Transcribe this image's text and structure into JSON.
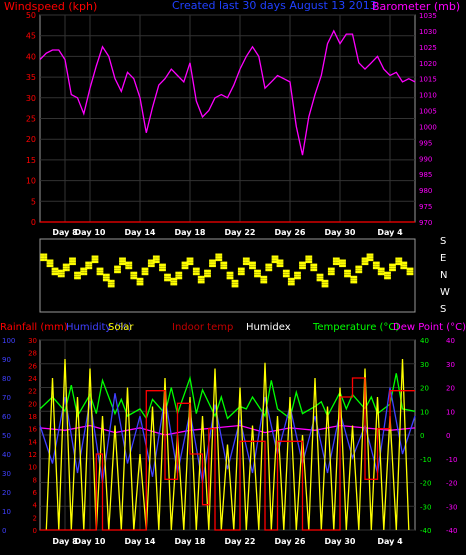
{
  "chart_data": [
    {
      "type": "line",
      "title": "Created last 30 days August 13 2013",
      "left_axis": {
        "label": "Windspeed (kph)",
        "min": 0,
        "max": 50,
        "ticks": [
          0,
          5,
          10,
          15,
          20,
          25,
          30,
          35,
          40,
          45,
          50
        ],
        "color": "#ff0000"
      },
      "right_axis": {
        "label": "Barometer (mb)",
        "min": 970,
        "max": 1035,
        "ticks": [
          970,
          975,
          980,
          985,
          990,
          995,
          1000,
          1005,
          1010,
          1015,
          1020,
          1025,
          1030,
          1035
        ],
        "color": "#ff00ff"
      },
      "x_labels": [
        "Day 8",
        "Day 10",
        "Day 14",
        "Day 18",
        "Day 22",
        "Day 26",
        "Day 30",
        "Day 4"
      ],
      "x_label_days": [
        8,
        10,
        14,
        18,
        22,
        26,
        30,
        34
      ],
      "x_range": [
        6,
        36
      ],
      "series": [
        {
          "name": "Barometer (mb)",
          "color": "#ff00ff",
          "axis": "right",
          "x": [
            6,
            6.5,
            7,
            7.5,
            8,
            8.5,
            9,
            9.5,
            10,
            10.5,
            11,
            11.5,
            12,
            12.5,
            13,
            13.5,
            14,
            14.5,
            15,
            15.5,
            16,
            16.5,
            17,
            17.5,
            18,
            18.5,
            19,
            19.5,
            20,
            20.5,
            21,
            21.5,
            22,
            22.5,
            23,
            23.5,
            24,
            24.5,
            25,
            25.5,
            26,
            26.5,
            27,
            27.5,
            28,
            28.5,
            29,
            29.5,
            30,
            30.5,
            31,
            31.5,
            32,
            32.5,
            33,
            33.5,
            34,
            34.5,
            35,
            35.5,
            36
          ],
          "y": [
            1021,
            1023,
            1024,
            1024,
            1021,
            1010,
            1009,
            1004,
            1012,
            1019,
            1025,
            1022,
            1015,
            1011,
            1017,
            1015,
            1009,
            998,
            1006,
            1013,
            1015,
            1018,
            1016,
            1014,
            1020,
            1008,
            1003,
            1005,
            1009,
            1010,
            1009,
            1013,
            1018,
            1022,
            1025,
            1022,
            1012,
            1014,
            1016,
            1015,
            1014,
            1000,
            991,
            1003,
            1010,
            1016,
            1026,
            1030,
            1026,
            1029,
            1029,
            1020,
            1018,
            1020,
            1022,
            1018,
            1016,
            1017,
            1014,
            1015,
            1014
          ]
        },
        {
          "name": "Windspeed (kph)",
          "color": "#ff0000",
          "axis": "left",
          "x": [
            6,
            36
          ],
          "y": [
            0,
            0
          ]
        }
      ]
    },
    {
      "type": "scatter",
      "title": "Wind direction",
      "direction_labels": [
        "S",
        "E",
        "N",
        "W",
        "S"
      ],
      "x_range": [
        6,
        36
      ],
      "color": "#ffff00",
      "series": [
        {
          "name": "Wind direction",
          "x": [
            6.3,
            6.8,
            7.2,
            7.7,
            8.1,
            8.6,
            9.0,
            9.5,
            9.9,
            10.4,
            10.8,
            11.3,
            11.7,
            12.2,
            12.6,
            13.1,
            13.5,
            14.0,
            14.4,
            14.9,
            15.3,
            15.8,
            16.2,
            16.7,
            17.1,
            17.6,
            18.0,
            18.5,
            18.9,
            19.4,
            19.8,
            20.3,
            20.7,
            21.2,
            21.6,
            22.1,
            22.5,
            23.0,
            23.4,
            23.9,
            24.3,
            24.8,
            25.2,
            25.7,
            26.1,
            26.6,
            27.0,
            27.5,
            27.9,
            28.4,
            28.8,
            29.3,
            29.7,
            30.2,
            30.6,
            31.1,
            31.5,
            32.0,
            32.4,
            32.9,
            33.3,
            33.8,
            34.2,
            34.7,
            35.1,
            35.6
          ],
          "y": [
            270,
            240,
            200,
            190,
            220,
            250,
            180,
            200,
            230,
            260,
            200,
            170,
            140,
            210,
            250,
            230,
            180,
            150,
            200,
            240,
            260,
            220,
            170,
            150,
            180,
            230,
            250,
            200,
            160,
            190,
            240,
            270,
            230,
            180,
            140,
            200,
            250,
            230,
            190,
            160,
            220,
            260,
            240,
            190,
            150,
            180,
            230,
            260,
            220,
            170,
            140,
            200,
            250,
            240,
            190,
            160,
            210,
            250,
            270,
            230,
            200,
            180,
            220,
            250,
            230,
            200
          ]
        }
      ]
    },
    {
      "type": "line",
      "title": "",
      "legend": [
        "Rainfall (mm)",
        "Humidity (%)",
        "Solar",
        "Indoor temp",
        "Humidex",
        "Temperature (°C)",
        "Dew Point (°C)"
      ],
      "axes": [
        {
          "name": "Humidity (%)",
          "min": 0,
          "max": 100,
          "ticks": [
            0,
            10,
            20,
            30,
            40,
            50,
            60,
            70,
            80,
            90,
            100
          ],
          "color": "#4040ff"
        },
        {
          "name": "Rainfall (mm)",
          "min": 0,
          "max": 30,
          "ticks": [
            0,
            2,
            4,
            6,
            8,
            10,
            12,
            14,
            16,
            18,
            20,
            22,
            24,
            26,
            28,
            30
          ],
          "color": "#ff0000"
        },
        {
          "name": "Temperature (°C)",
          "min": -40,
          "max": 40,
          "ticks": [
            -40,
            -30,
            -20,
            -10,
            0,
            10,
            20,
            30,
            40
          ],
          "color": "#00ff00"
        },
        {
          "name": "Dew Point (°C)",
          "min": -40,
          "max": 40,
          "ticks": [
            -40,
            -30,
            -20,
            -10,
            0,
            10,
            20,
            30,
            40
          ],
          "color": "#ff00ff"
        }
      ],
      "x_range": [
        6,
        36
      ],
      "series": [
        {
          "name": "Temperature (°C)",
          "color": "#00ff00",
          "axis": "Temperature (°C)",
          "x": [
            6,
            7,
            8,
            8.5,
            9,
            10,
            10.5,
            11,
            12,
            12.5,
            13,
            14,
            14.5,
            15,
            16,
            16.5,
            17,
            18,
            18.5,
            19,
            20,
            20.5,
            21,
            22,
            22.5,
            23,
            24,
            24.5,
            25,
            26,
            26.5,
            27,
            28,
            28.5,
            29,
            30,
            30.5,
            31,
            32,
            32.5,
            33,
            34,
            34.5,
            35,
            36
          ],
          "y": [
            11,
            16,
            10,
            21,
            8,
            17,
            9,
            23,
            9,
            15,
            8,
            11,
            7,
            15,
            9,
            20,
            9,
            24,
            9,
            19,
            8,
            16,
            7,
            12,
            11,
            16,
            8,
            23,
            11,
            7,
            18,
            9,
            12,
            14,
            8,
            18,
            11,
            17,
            11,
            16,
            9,
            13,
            26,
            11,
            10
          ]
        },
        {
          "name": "Dew Point (°C)",
          "color": "#ff00ff",
          "axis": "Dew Point (°C)",
          "x": [
            6,
            8,
            10,
            12,
            14,
            16,
            18,
            20,
            22,
            24,
            26,
            28,
            30,
            32,
            34,
            36
          ],
          "y": [
            3,
            2,
            4,
            1,
            3,
            0,
            2,
            3,
            4,
            1,
            3,
            2,
            4,
            3,
            2,
            3
          ]
        },
        {
          "name": "Humidity (%)",
          "color": "#4040ff",
          "axis": "Humidity (%)",
          "x": [
            6,
            7,
            8,
            9,
            10,
            11,
            12,
            13,
            14,
            15,
            16,
            17,
            18,
            19,
            20,
            21,
            22,
            23,
            24,
            25,
            26,
            27,
            28,
            29,
            30,
            31,
            32,
            33,
            34,
            35,
            36
          ],
          "y": [
            55,
            35,
            70,
            30,
            68,
            25,
            72,
            35,
            60,
            28,
            70,
            30,
            62,
            25,
            66,
            32,
            58,
            30,
            70,
            40,
            65,
            35,
            60,
            30,
            62,
            38,
            55,
            30,
            75,
            40,
            60
          ]
        },
        {
          "name": "Solar",
          "color": "#ffff00",
          "axis": "Humidity (%)",
          "x": [
            6.5,
            7,
            7.5,
            8,
            8.5,
            9,
            9.5,
            10,
            10.5,
            11,
            11.5,
            12,
            12.5,
            13,
            13.5,
            14,
            14.5,
            15,
            15.5,
            16,
            16.5,
            17,
            17.5,
            18,
            18.5,
            19,
            19.5,
            20,
            20.5,
            21,
            21.5,
            22,
            22.5,
            23,
            23.5,
            24,
            24.5,
            25,
            25.5,
            26,
            26.5,
            27,
            27.5,
            28,
            28.5,
            29,
            29.5,
            30,
            30.5,
            31,
            31.5,
            32,
            32.5,
            33,
            33.5,
            34,
            34.5,
            35,
            35.5
          ],
          "y": [
            0,
            80,
            0,
            90,
            0,
            70,
            0,
            85,
            0,
            60,
            0,
            55,
            0,
            75,
            0,
            40,
            0,
            65,
            0,
            80,
            0,
            50,
            0,
            70,
            0,
            60,
            0,
            85,
            0,
            45,
            0,
            75,
            0,
            55,
            0,
            88,
            0,
            60,
            0,
            70,
            0,
            50,
            0,
            80,
            0,
            65,
            0,
            75,
            0,
            55,
            0,
            85,
            0,
            70,
            0,
            60,
            0,
            90,
            0
          ]
        },
        {
          "name": "Rainfall (mm)",
          "color": "#ff0000",
          "axis": "Rainfall (mm)",
          "x": [
            6,
            10,
            10.5,
            11,
            13,
            14.5,
            16,
            17,
            18,
            19,
            19.5,
            20,
            22,
            24,
            25,
            26,
            27,
            28,
            29,
            30,
            31,
            32,
            33,
            34,
            35,
            36
          ],
          "y": [
            0,
            0,
            12,
            0,
            0,
            22,
            8,
            20,
            12,
            4,
            16,
            0,
            14,
            0,
            14,
            14,
            0,
            0,
            0,
            21,
            24,
            8,
            16,
            22,
            22,
            22
          ]
        }
      ]
    }
  ]
}
